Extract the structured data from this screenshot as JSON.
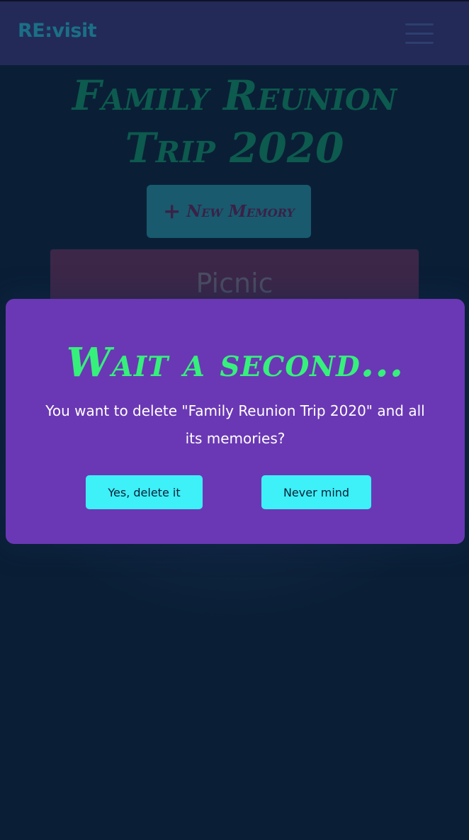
{
  "navbar": {
    "brand": "RE:visit",
    "menu_icon": "hamburger-menu-icon"
  },
  "trip": {
    "title": "Family Reunion Trip 2020"
  },
  "new_memory_button": {
    "icon": "plus-icon",
    "icon_glyph": "+",
    "label": "New Memory"
  },
  "memories": [
    {
      "title": "Picnic"
    }
  ],
  "modal": {
    "heading": "Wait a second...",
    "message": "You want to delete \"Family Reunion Trip 2020\" and all its memories?",
    "confirm_label": "Yes, delete it",
    "cancel_label": "Never mind"
  },
  "colors": {
    "page_background": "#0a1f36",
    "navbar_background": "#232a58",
    "modal_background": "#6a38b4",
    "heading_green": "#36f07c",
    "button_cyan": "#3ef0f8"
  }
}
